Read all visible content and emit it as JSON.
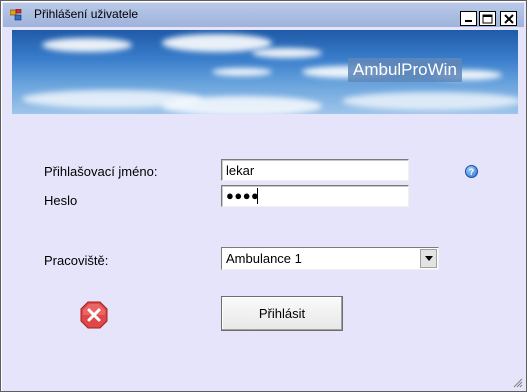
{
  "window": {
    "title": "Přihlášení uživatele"
  },
  "banner": {
    "brand": "AmbulProWin"
  },
  "form": {
    "username_label": "Přihlašovací jméno:",
    "username_value": "lekar",
    "password_label": "Heslo",
    "password_value": "●●●●",
    "workplace_label": "Pracoviště:",
    "workplace_selected": "Ambulance 1",
    "login_label": "Přihlásit"
  },
  "icons": {
    "app": "app-window-icon",
    "help": "help-icon",
    "cancel": "cancel-icon",
    "help_glyph": "?"
  }
}
